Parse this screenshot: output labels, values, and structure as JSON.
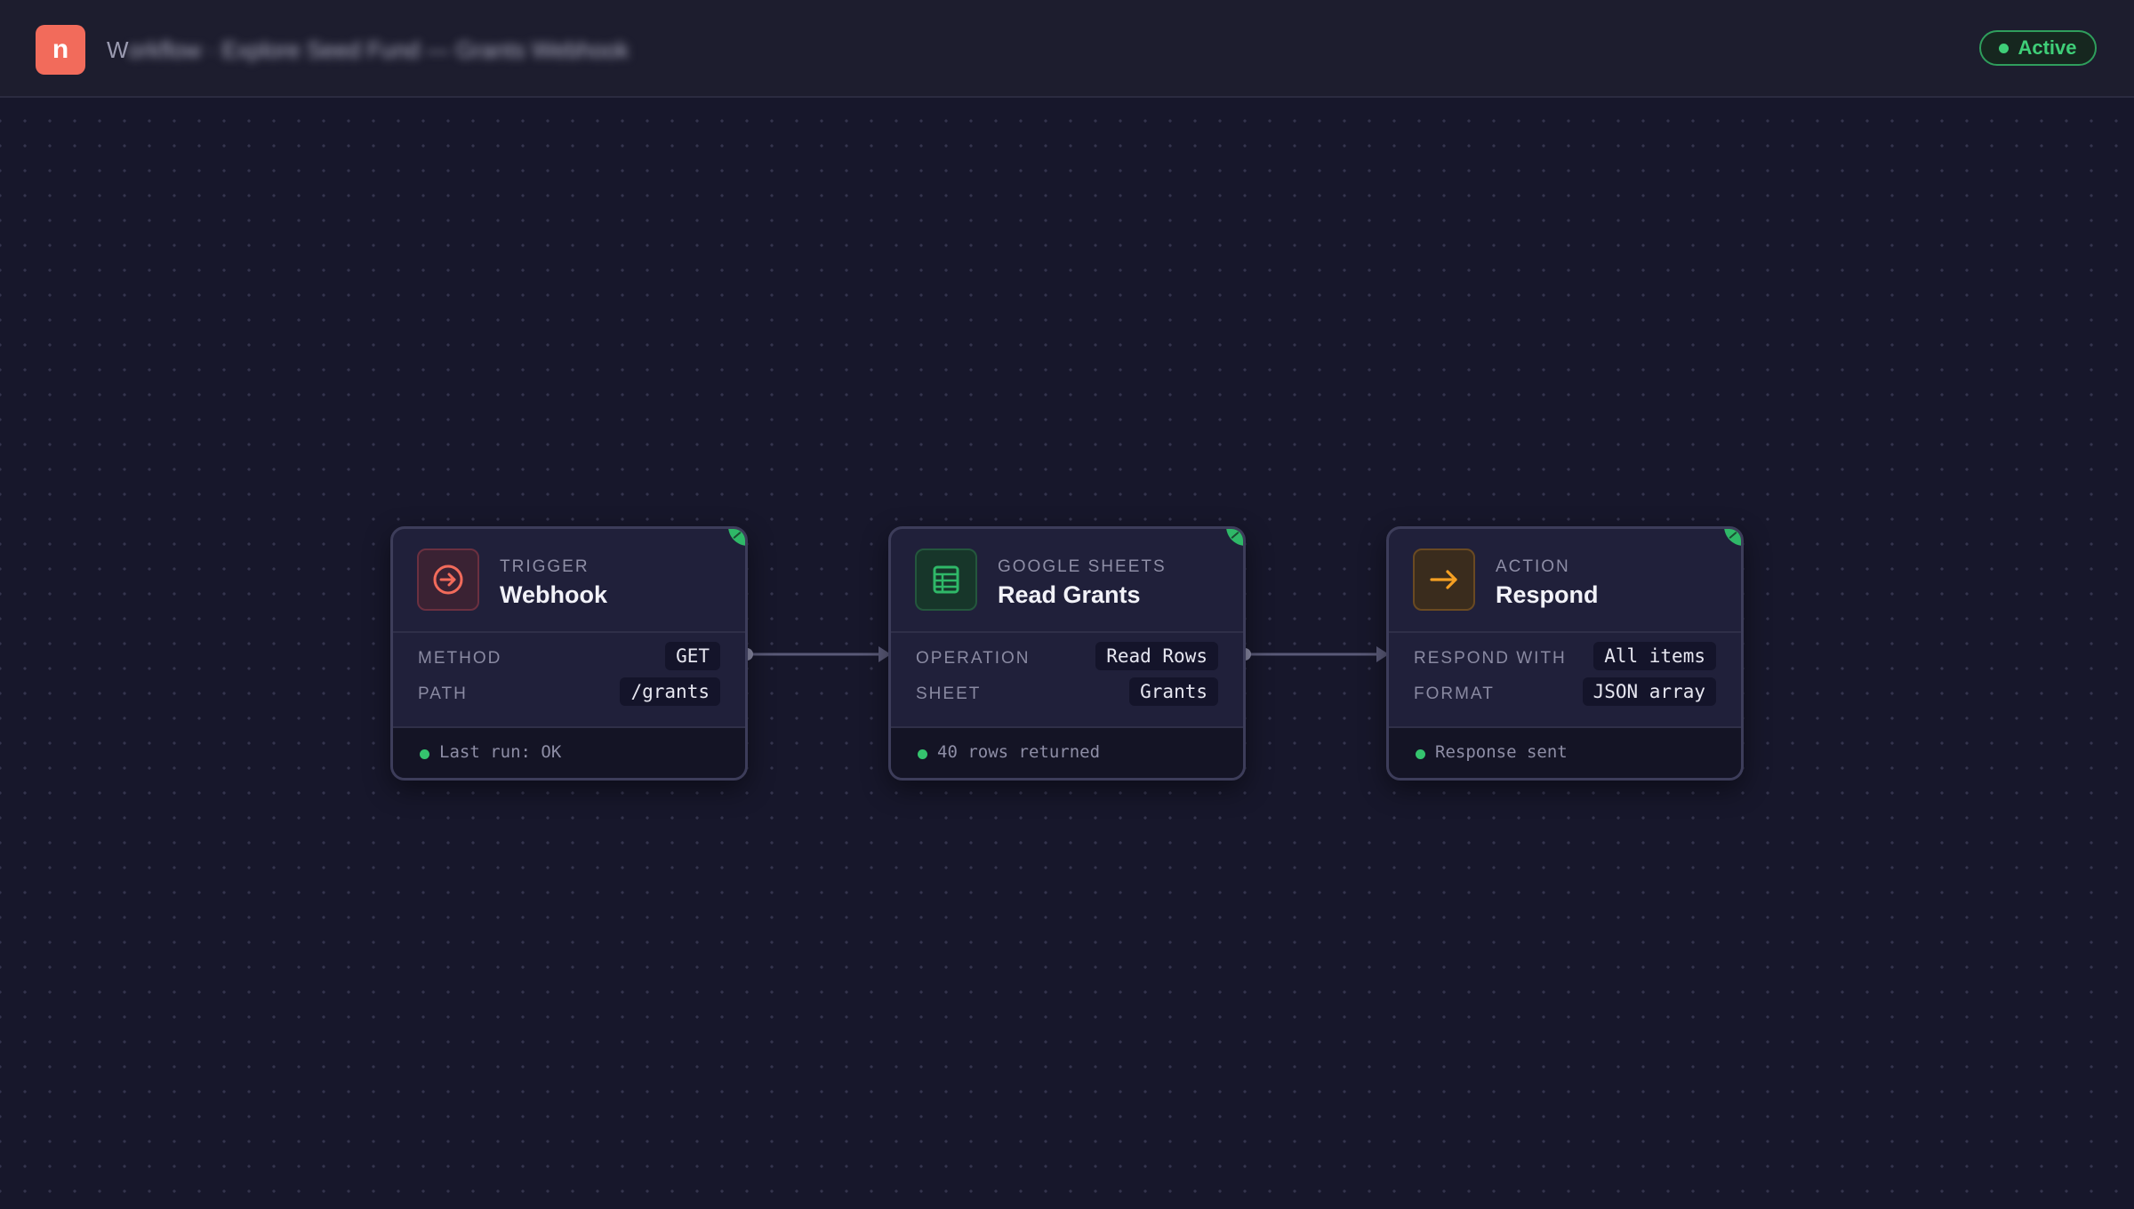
{
  "app": {
    "logo_letter": "n"
  },
  "header": {
    "title_visible": "W",
    "title_blurred": "orkflow · Explore Seed Fund — Grants Webhook",
    "status_label": "Active",
    "status_color": "#3fcf78"
  },
  "nodes": [
    {
      "kind": "TRIGGER",
      "name": "Webhook",
      "icon": "arrow-circle-icon",
      "accent": "#f26b5b",
      "params": [
        {
          "label": "METHOD",
          "value": "GET"
        },
        {
          "label": "PATH",
          "value": "/grants"
        }
      ],
      "status": "Last run: OK"
    },
    {
      "kind": "GOOGLE SHEETS",
      "name": "Read Grants",
      "icon": "spreadsheet-icon",
      "accent": "#2fb868",
      "params": [
        {
          "label": "OPERATION",
          "value": "Read Rows"
        },
        {
          "label": "SHEET",
          "value": "Grants"
        }
      ],
      "status": "40 rows returned"
    },
    {
      "kind": "ACTION",
      "name": "Respond",
      "icon": "arrow-right-icon",
      "accent": "#f5a023",
      "params": [
        {
          "label": "RESPOND WITH",
          "value": "All items"
        },
        {
          "label": "FORMAT",
          "value": "JSON array"
        }
      ],
      "status": "Response sent"
    }
  ]
}
